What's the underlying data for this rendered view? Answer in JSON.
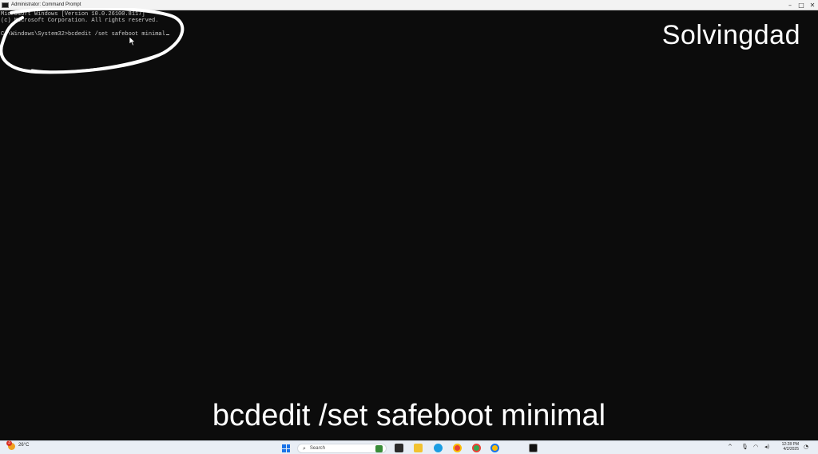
{
  "window": {
    "title": "Administrator: Command Prompt",
    "controls": {
      "minimize": "–",
      "maximize": "□",
      "close": "✕"
    }
  },
  "console": {
    "lines": [
      "Microsoft Windows [Version 10.0.26100.8117]",
      "(c) Microsoft Corporation. All rights reserved.",
      "",
      "C:\\Windows\\System32>bcdedit /set safeboot minimal"
    ]
  },
  "overlay": {
    "watermark": "Solvingdad",
    "caption": "bcdedit /set safeboot minimal",
    "annotation_color": "#ffffff"
  },
  "taskbar": {
    "weather": {
      "temp": "26°C",
      "badge": "3"
    },
    "search_placeholder": "Search",
    "apps": [
      "file-explorer-icon",
      "edge-icon",
      "chrome-icon",
      "chrome-profile-icon",
      "terminal-icon"
    ],
    "clock": {
      "time": "12:28 PM",
      "date": "4/2/2025"
    }
  },
  "colors": {
    "console_bg": "#0c0c0c",
    "console_text": "#cccccc",
    "titlebar_bg": "#f3f3f3",
    "taskbar_bg": "#e9eef5",
    "accent": "#1a73e8"
  }
}
